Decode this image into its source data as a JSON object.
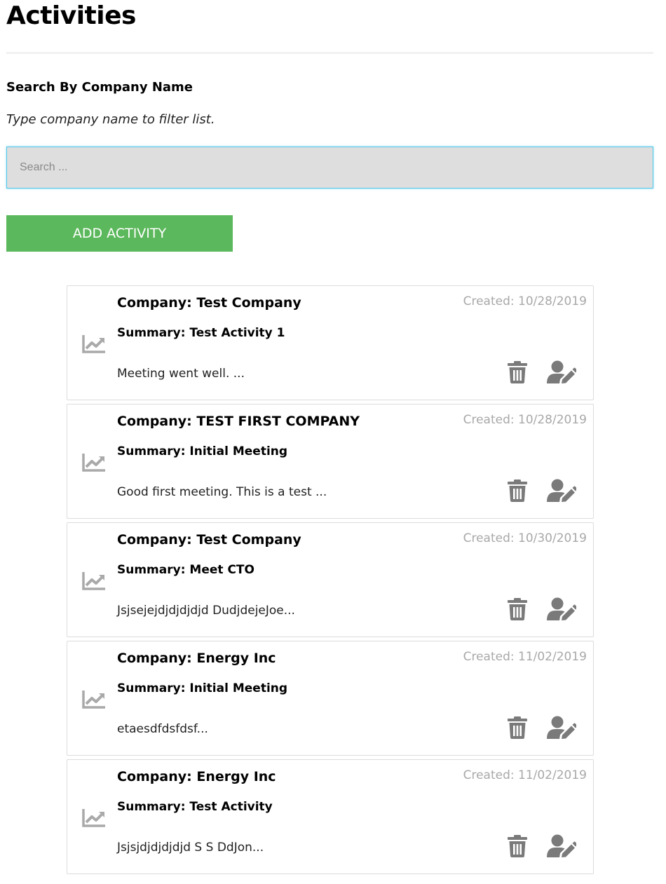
{
  "page": {
    "title": "Activities"
  },
  "filter": {
    "heading": "Search By Company Name",
    "help": "Type company name to filter list.",
    "placeholder": "Search ..."
  },
  "actions": {
    "add_label": "ADD ACTIVITY"
  },
  "icons": {
    "chart": "chart-line-icon",
    "delete": "trash-icon",
    "edit": "user-edit-icon"
  },
  "colors": {
    "accent_green": "#5cb85c",
    "icon_gray": "#7a7a7a",
    "date_gray": "#a8a8a8",
    "search_focus": "#4fc8ea"
  },
  "activities": [
    {
      "company": "Company: Test Company",
      "created": "Created: 10/28/2019",
      "summary": "Summary: Test Activity 1",
      "description": "Meeting went well. ..."
    },
    {
      "company": "Company: TEST FIRST COMPANY",
      "created": "Created: 10/28/2019",
      "summary": "Summary: Initial Meeting",
      "description": "Good first meeting. This is a test ..."
    },
    {
      "company": "Company: Test Company",
      "created": "Created: 10/30/2019",
      "summary": "Summary: Meet CTO",
      "description": "Jsjsejejdjdjdjdjd DudjdejeJoe..."
    },
    {
      "company": "Company: Energy Inc",
      "created": "Created: 11/02/2019",
      "summary": "Summary: Initial Meeting",
      "description": "etaesdfdsfdsf..."
    },
    {
      "company": "Company: Energy Inc",
      "created": "Created: 11/02/2019",
      "summary": "Summary: Test Activity",
      "description": "Jsjsjdjdjdjdjd S S DdJon..."
    }
  ]
}
